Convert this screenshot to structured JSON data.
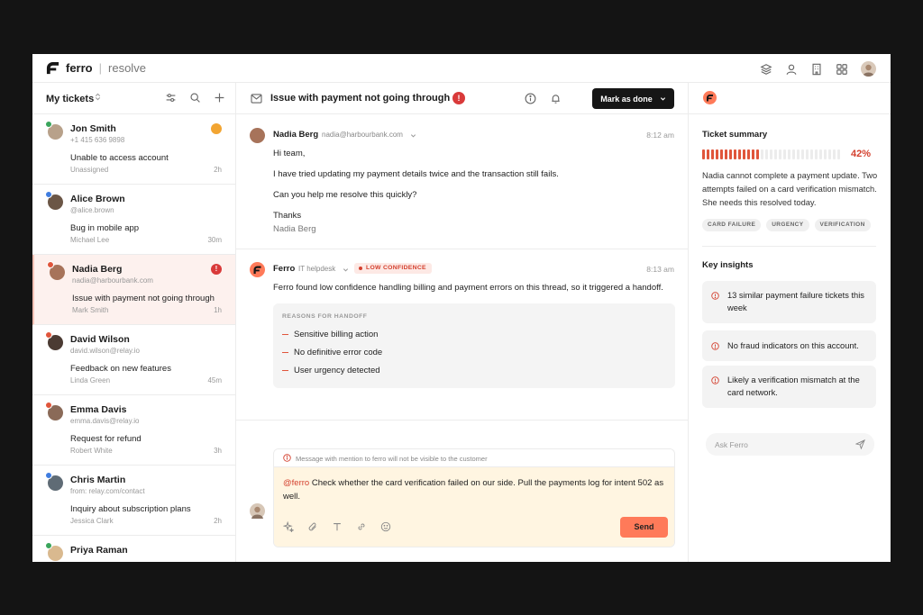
{
  "app": {
    "brand": "ferro",
    "separator": "|",
    "product": "resolve"
  },
  "left": {
    "title": "My tickets",
    "tickets": [
      {
        "name": "Jon Smith",
        "sub": "+1 415 636 9898",
        "subject": "Unable to access account",
        "agent": "Unassigned",
        "time": "2h",
        "avatar_color": "#b8a18a",
        "channel_color": "#3aa55c",
        "badge_color": "#f2a532",
        "badge_icon": "flag-icon"
      },
      {
        "name": "Alice Brown",
        "sub": "@alice.brown",
        "subject": "Bug in mobile app",
        "agent": "Michael Lee",
        "time": "30m",
        "avatar_color": "#6b5646",
        "channel_color": "#3f7de0"
      },
      {
        "name": "Nadia Berg",
        "sub": "nadia@harbourbank.com",
        "subject": "Issue with payment not going through",
        "agent": "Mark Smith",
        "time": "1h",
        "avatar_color": "#a7735a",
        "channel_color": "#e0553b",
        "badge_color": "#d93a3a",
        "badge_text": "!"
      },
      {
        "name": "David Wilson",
        "sub": "david.wilson@relay.io",
        "subject": "Feedback on new features",
        "agent": "Linda Green",
        "time": "45m",
        "avatar_color": "#4b3b33",
        "channel_color": "#e0553b"
      },
      {
        "name": "Emma Davis",
        "sub": "emma.davis@relay.io",
        "subject": "Request for refund",
        "agent": "Robert White",
        "time": "3h",
        "avatar_color": "#8a6a58",
        "channel_color": "#e0553b"
      },
      {
        "name": "Chris Martin",
        "sub": "from: relay.com/contact",
        "subject": "Inquiry about subscription plans",
        "agent": "Jessica Clark",
        "time": "2h",
        "avatar_color": "#5f6b75",
        "channel_color": "#3f7de0"
      },
      {
        "name": "Priya Raman",
        "sub": "",
        "subject": "",
        "agent": "",
        "time": "",
        "avatar_color": "#d9b98f",
        "channel_color": "#3aa55c"
      }
    ]
  },
  "thread": {
    "title": "Issue with payment not going through",
    "alert": "!",
    "done_label": "Mark as done",
    "message1": {
      "name": "Nadia Berg",
      "email": "nadia@harbourbank.com",
      "time": "8:12 am",
      "lines": [
        "Hi team,",
        "I have tried updating my payment details twice and the transaction still fails.",
        "Can you help me resolve this quickly?",
        "Thanks",
        "Nadia Berg"
      ]
    },
    "message2": {
      "name": "Ferro",
      "team": "IT helpdesk",
      "confidence": "LOW CONFIDENCE",
      "time": "8:13 am",
      "text": "Ferro found low confidence handling billing and payment errors on this thread, so it triggered a handoff.",
      "reasons_title": "REASONS FOR HANDOFF",
      "reasons": [
        "Sensitive billing action",
        "No definitive error code",
        "User urgency detected"
      ]
    },
    "composer": {
      "note": "Message with mention to ferro will not be visible to the customer",
      "mention": "@ferro",
      "text": " Check whether the card verification failed on our side. Pull the payments log for intent 502 as well.",
      "send_label": "Send"
    }
  },
  "summary": {
    "title": "Ticket summary",
    "percent": "42%",
    "progress": 0.42,
    "text": "Nadia cannot complete a payment update. Two attempts failed on a card verification mismatch. She needs this resolved today.",
    "tags": [
      "CARD FAILURE",
      "URGENCY",
      "VERIFICATION"
    ],
    "insights_title": "Key insights",
    "insights": [
      "13 similar payment failure tickets this week",
      "No fraud indicators on this account.",
      "Likely a verification mismatch at the card network."
    ],
    "ask_placeholder": "Ask Ferro"
  },
  "colors": {
    "accent": "#ff7a59",
    "danger": "#d93a3a",
    "composer_bg": "#fff5e1"
  }
}
